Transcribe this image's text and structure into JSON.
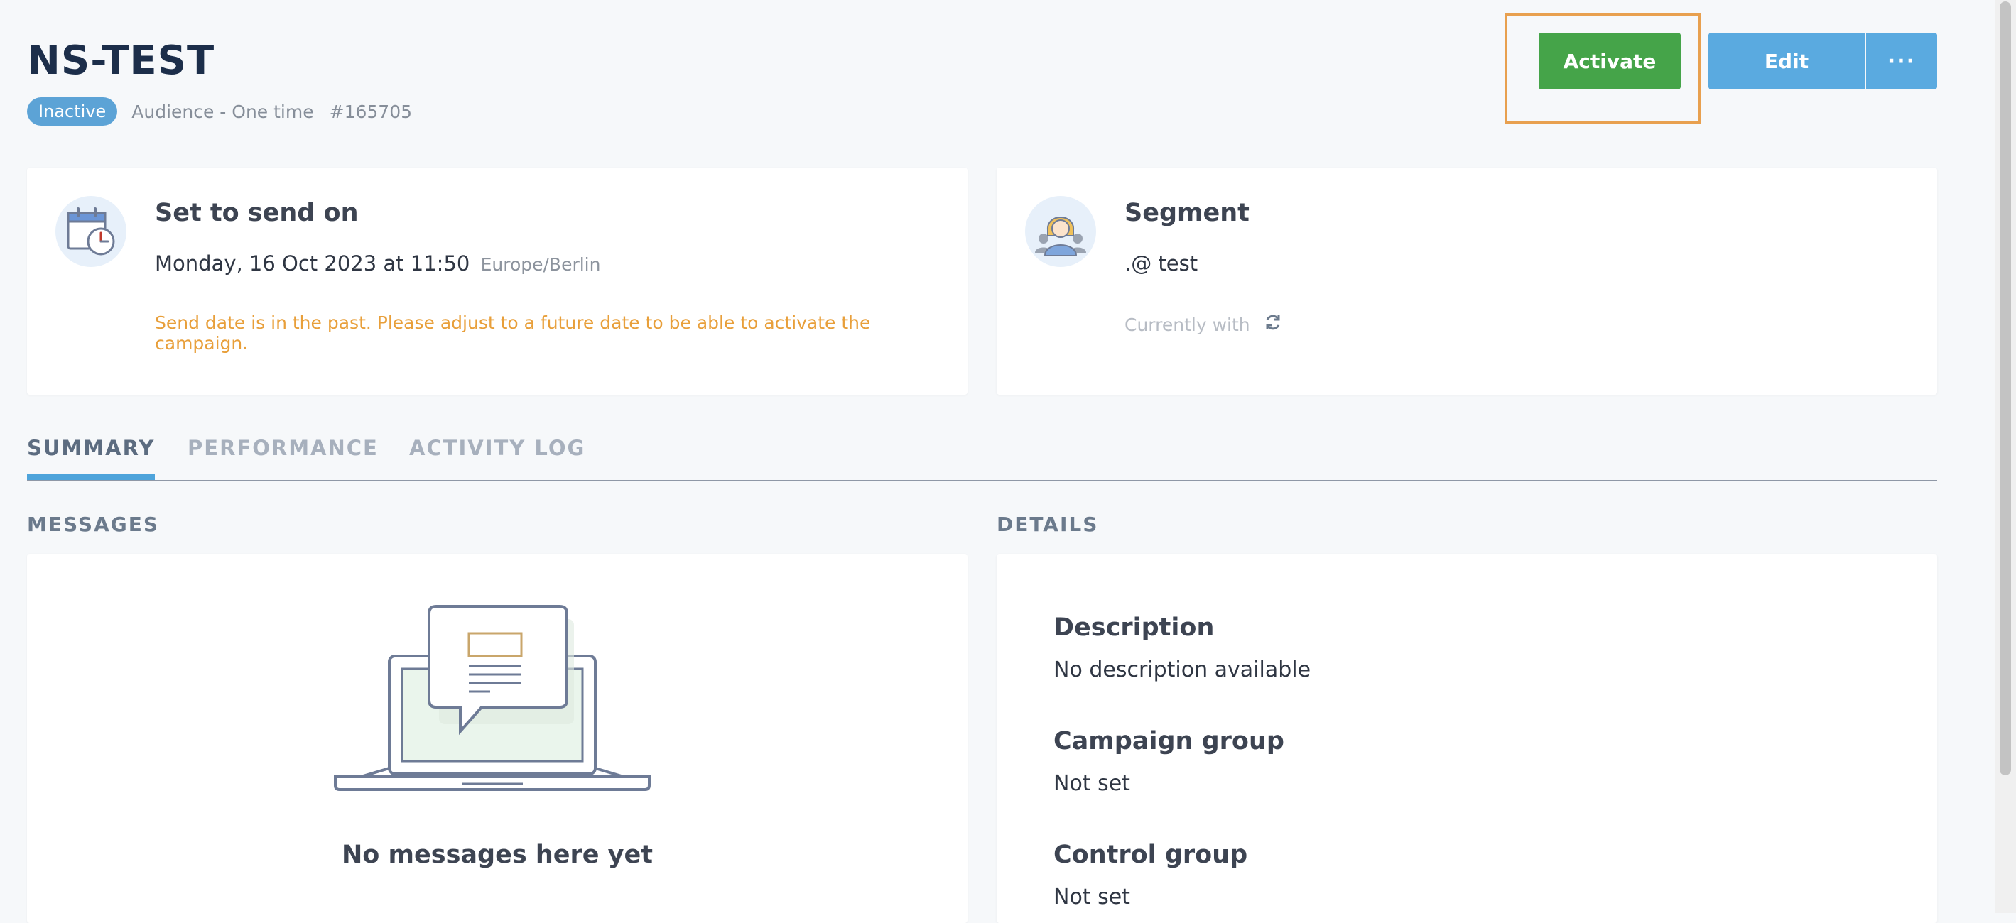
{
  "header": {
    "title": "NS-TEST",
    "status": "Inactive",
    "type": "Audience - One time",
    "id": "#165705"
  },
  "actions": {
    "activate": "Activate",
    "edit": "Edit",
    "more": "···"
  },
  "send_card": {
    "heading": "Set to send on",
    "datetime": "Monday, 16 Oct 2023 at 11:50",
    "timezone": "Europe/Berlin",
    "warning": "Send date is in the past. Please adjust to a future date to be able to activate the campaign."
  },
  "segment_card": {
    "heading": "Segment",
    "name": ".@ test",
    "currently": "Currently with"
  },
  "tabs": [
    {
      "label": "SUMMARY",
      "active": true
    },
    {
      "label": "PERFORMANCE",
      "active": false
    },
    {
      "label": "ACTIVITY LOG",
      "active": false
    }
  ],
  "messages": {
    "label": "MESSAGES",
    "empty": "No messages here yet"
  },
  "details": {
    "label": "DETAILS",
    "items": [
      {
        "title": "Description",
        "value": "No description available"
      },
      {
        "title": "Campaign group",
        "value": "Not set"
      },
      {
        "title": "Control group",
        "value": "Not set"
      }
    ]
  },
  "colors": {
    "activate": "#45a449",
    "edit": "#5aaae0",
    "badge": "#5ca3d6",
    "warning": "#e89f3a",
    "highlight": "#e8a04f"
  }
}
